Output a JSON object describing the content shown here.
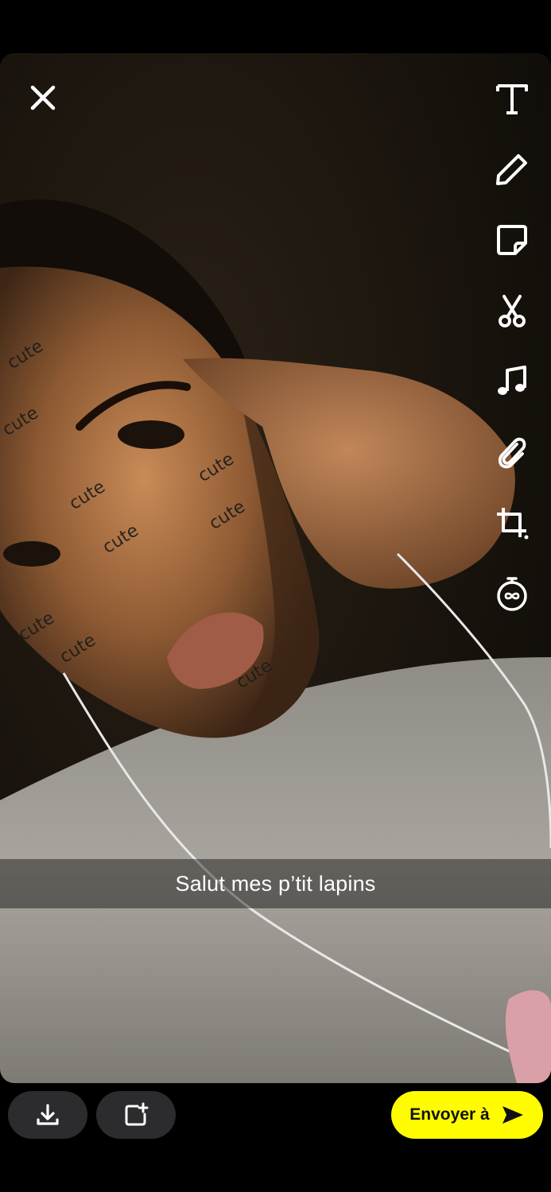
{
  "caption": {
    "text": "Salut mes p’tit lapins"
  },
  "sticker": {
    "word": "cute"
  },
  "toolbar": {
    "items": [
      {
        "icon": "text-icon",
        "label": "Text"
      },
      {
        "icon": "pencil-icon",
        "label": "Draw"
      },
      {
        "icon": "sticker-icon",
        "label": "Stickers"
      },
      {
        "icon": "scissors-icon",
        "label": "Scissors"
      },
      {
        "icon": "music-icon",
        "label": "Music"
      },
      {
        "icon": "paperclip-icon",
        "label": "Link"
      },
      {
        "icon": "crop-icon",
        "label": "Crop"
      },
      {
        "icon": "timer-icon",
        "label": "Timer"
      }
    ]
  },
  "bottom": {
    "save_icon": "download-icon",
    "story_icon": "add-story-icon",
    "send_label": "Envoyer à",
    "send_icon": "send-arrow-icon"
  },
  "colors": {
    "accent": "#fffc00",
    "button_bg": "#2c2c2e"
  }
}
